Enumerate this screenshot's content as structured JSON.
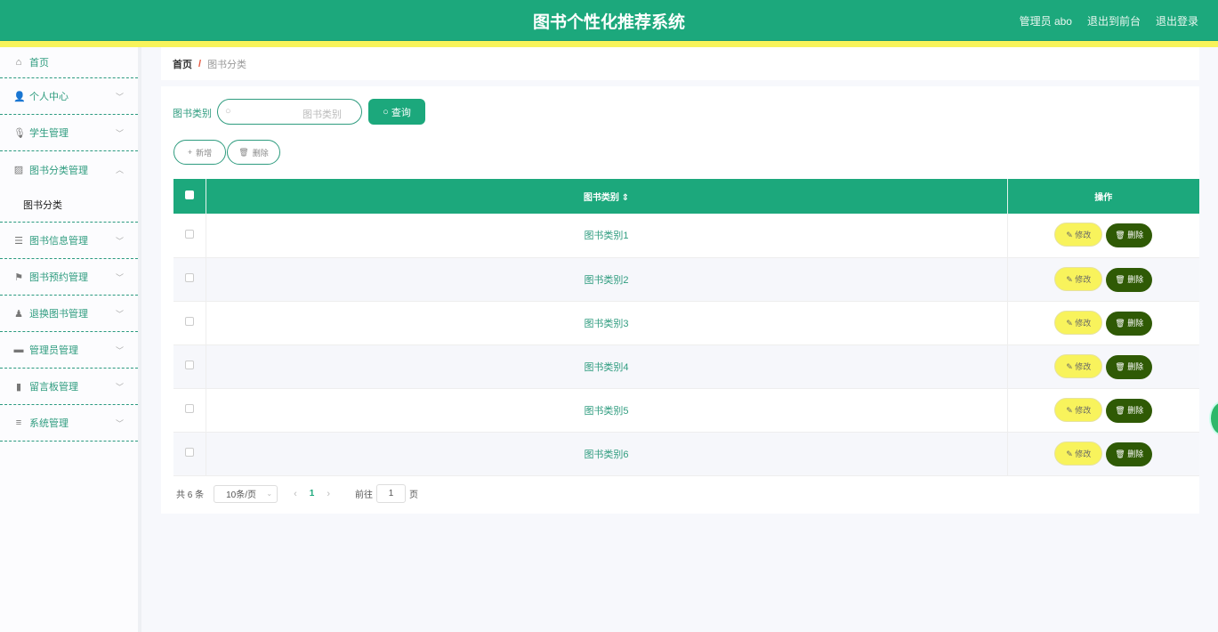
{
  "header": {
    "title": "图书个性化推荐系统",
    "user": "管理员 abo",
    "front": "退出到前台",
    "logout": "退出登录"
  },
  "sidebar": {
    "home": "首页",
    "items": [
      {
        "label": "个人中心",
        "icon": "user-icon"
      },
      {
        "label": "学生管理",
        "icon": "mic-icon"
      },
      {
        "label": "图书分类管理",
        "icon": "chart-icon",
        "open": true,
        "sub": "图书分类"
      },
      {
        "label": "图书信息管理",
        "icon": "list-icon"
      },
      {
        "label": "图书预约管理",
        "icon": "flag-icon"
      },
      {
        "label": "退换图书管理",
        "icon": "person-icon"
      },
      {
        "label": "管理员管理",
        "icon": "monitor-icon"
      },
      {
        "label": "留言板管理",
        "icon": "bar-chart-icon"
      },
      {
        "label": "系统管理",
        "icon": "menu-icon"
      }
    ]
  },
  "breadcrumb": {
    "home": "首页",
    "sep": "/",
    "current": "图书分类"
  },
  "search": {
    "label": "图书类别",
    "placeholder": "图书类别",
    "query": "查询"
  },
  "actions": {
    "add": "新增",
    "delete": "删除"
  },
  "table": {
    "headers": {
      "category": "图书类别",
      "ops": "操作"
    },
    "rows": [
      "图书类别1",
      "图书类别2",
      "图书类别3",
      "图书类别4",
      "图书类别5",
      "图书类别6"
    ],
    "edit": "修改",
    "delete": "删除"
  },
  "pager": {
    "total": "共 6 条",
    "size": "10条/页",
    "page": "1",
    "goto": "前往",
    "goto_value": "1",
    "unit": "页"
  }
}
